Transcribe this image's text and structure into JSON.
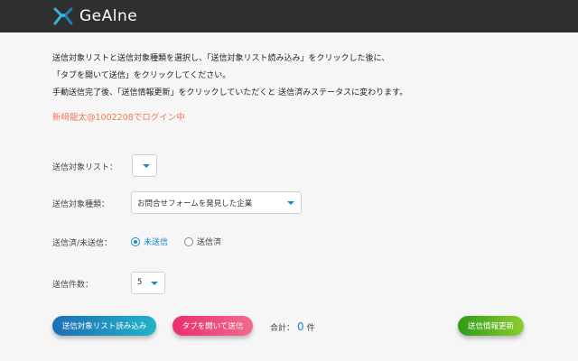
{
  "header": {
    "logo_text": "GeAlne",
    "logo_icon": "x-logo-icon"
  },
  "intro": {
    "line1": "送信対象リストと送信対象種類を選択し、「送信対象リスト読み込み」をクリックした後に、",
    "line2": "「タブを開いて送信」をクリックしてください。",
    "line3": "手動送信完了後、「送信情報更新」をクリックしていただくと 送信済みステータスに変わります。"
  },
  "login_status": "新﨑龍太@1002208でログイン中",
  "form": {
    "list_label": "送信対象リスト：",
    "list_value": "",
    "type_label": "送信対象種類：",
    "type_value": "お問合せフォームを発見した企業",
    "status_label": "送信済/未送信：",
    "status_options": [
      {
        "label": "未送信",
        "checked": true
      },
      {
        "label": "送信済",
        "checked": false
      }
    ],
    "count_label": "送信件数：",
    "count_value": "5"
  },
  "actions": {
    "load_label": "送信対象リスト読み込み",
    "open_tabs_label": "タブを開いて送信",
    "total_prefix": "合計：",
    "total_value": "0",
    "total_suffix": "件",
    "update_label": "送信情報更新"
  },
  "colors": {
    "header_bg": "#2f2f2f",
    "accent_blue": "#1b8ac9",
    "login_text": "#ef7a55",
    "button_pink": "#e8306f",
    "button_green": "#2f9a1c"
  }
}
